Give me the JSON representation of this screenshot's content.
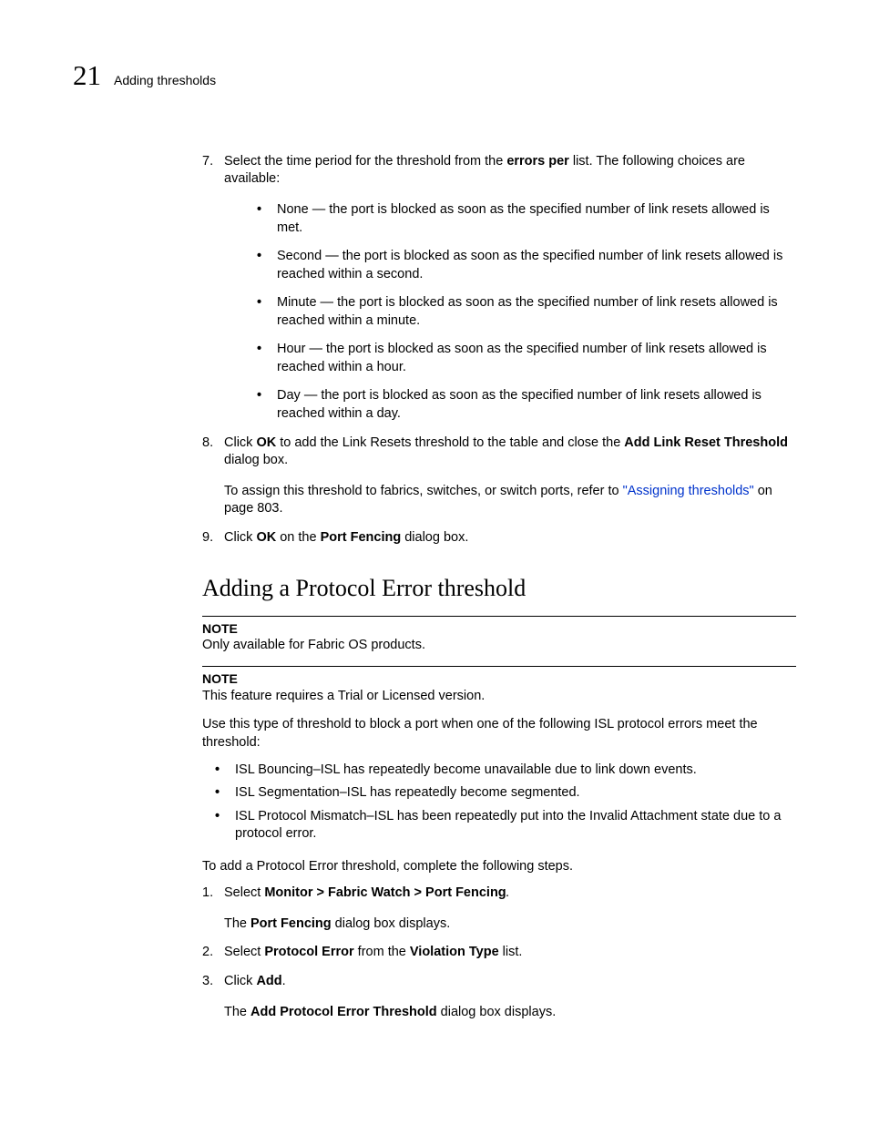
{
  "header": {
    "chapter_number": "21",
    "chapter_title": "Adding thresholds"
  },
  "step7": {
    "marker": "7.",
    "lead": "Select the time period for the threshold from the ",
    "bold1": "errors per",
    "tail": " list. The following choices are available:",
    "items": {
      "none": "None — the port is blocked as soon as the specified number of link resets allowed is met.",
      "second": "Second — the port is blocked as soon as the specified number of link resets allowed is reached within a second.",
      "minute": "Minute — the port is blocked as soon as the specified number of link resets allowed is reached within a minute.",
      "hour": "Hour — the port is blocked as soon as the specified number of link resets allowed is reached within a hour.",
      "day": "Day — the port is blocked as soon as the specified number of link resets allowed is reached within a day."
    }
  },
  "step8": {
    "marker": "8.",
    "pre": "Click ",
    "ok": "OK",
    "mid": " to add the Link Resets threshold to the table and close the ",
    "dlg": "Add Link Reset Threshold",
    "post": " dialog box.",
    "after_pre": "To assign this threshold to fabrics, switches, or switch ports, refer to ",
    "after_link": "\"Assigning thresholds\"",
    "after_post": " on page 803."
  },
  "step9": {
    "marker": "9.",
    "pre": "Click ",
    "ok": "OK",
    "mid": " on the ",
    "dlg": "Port Fencing",
    "post": " dialog box."
  },
  "section_title": "Adding a Protocol Error threshold",
  "note1": {
    "label": "NOTE",
    "text": "Only available for Fabric OS products."
  },
  "note2": {
    "label": "NOTE",
    "text": "This feature requires a Trial or Licensed version."
  },
  "intro_para": "Use this type of threshold to block a port when one of the following ISL protocol errors meet the threshold:",
  "isl_items": {
    "bouncing": "ISL Bouncing–ISL has repeatedly become unavailable due to link down events.",
    "segmentation": "ISL Segmentation–ISL has repeatedly become segmented.",
    "mismatch": "ISL Protocol Mismatch–ISL has been repeatedly put into the Invalid Attachment state due to a protocol error."
  },
  "add_para": "To add a Protocol Error threshold, complete the following steps.",
  "proc": {
    "s1": {
      "marker": "1.",
      "pre": "Select ",
      "bold": "Monitor > Fabric Watch > Port Fencing",
      "post": ".",
      "after_pre": "The ",
      "after_bold": "Port Fencing",
      "after_post": " dialog box displays."
    },
    "s2": {
      "marker": "2.",
      "pre": "Select ",
      "bold1": "Protocol Error",
      "mid": " from the ",
      "bold2": "Violation Type",
      "post": " list."
    },
    "s3": {
      "marker": "3.",
      "pre": "Click ",
      "bold": "Add",
      "post": ".",
      "after_pre": "The ",
      "after_bold": "Add Protocol Error Threshold",
      "after_post": " dialog box displays."
    }
  }
}
